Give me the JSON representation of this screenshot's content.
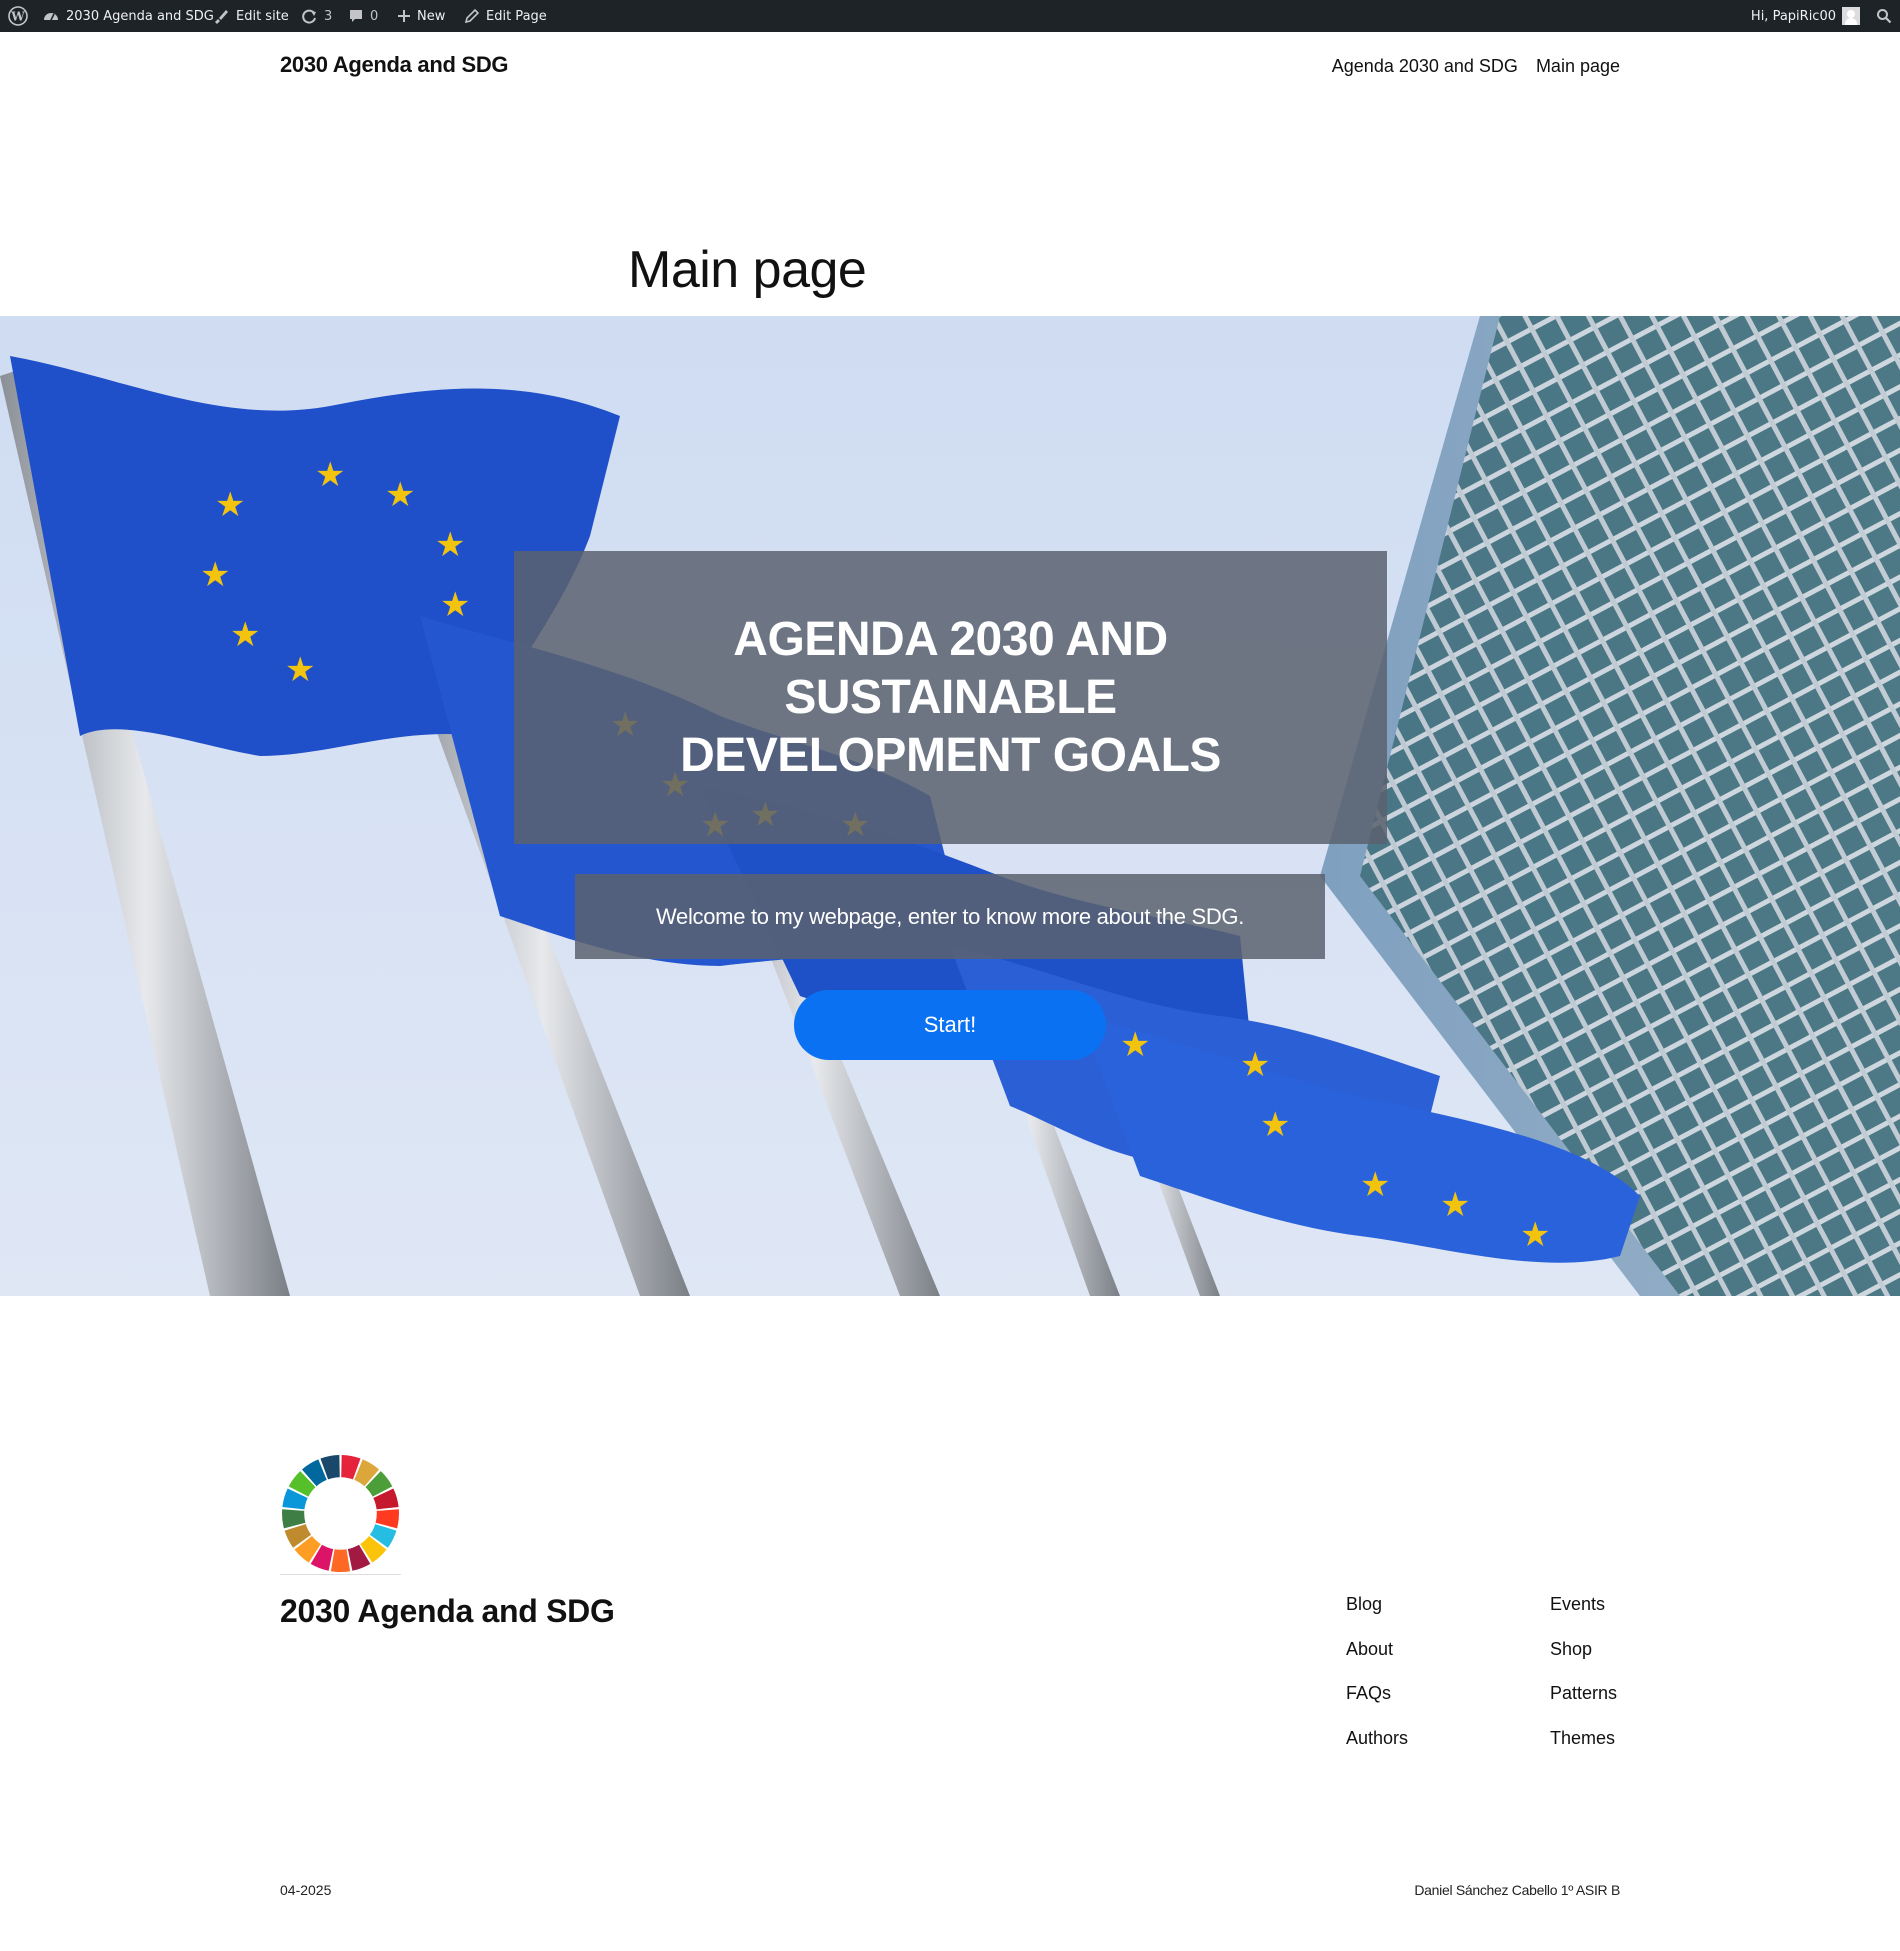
{
  "admin_bar": {
    "site_name": "2030 Agenda and SDG",
    "edit_site": "Edit site",
    "updates_count": "3",
    "comments_count": "0",
    "new_label": "New",
    "edit_page": "Edit Page",
    "greeting": "Hi, PapiRic00"
  },
  "header": {
    "site_title": "2030 Agenda and SDG",
    "nav": [
      "Agenda 2030 and SDG",
      "Main page"
    ]
  },
  "page": {
    "title": "Main page"
  },
  "hero": {
    "heading": "AGENDA 2030 AND SUSTAINABLE DEVELOPMENT GOALS",
    "subtext": "Welcome to my webpage, enter to know more about the SDG.",
    "button": "Start!",
    "button_color": "#0a72f2"
  },
  "footer": {
    "title": "2030 Agenda and SDG",
    "links_col1": [
      "Blog",
      "About",
      "FAQs",
      "Authors"
    ],
    "links_col2": [
      "Events",
      "Shop",
      "Patterns",
      "Themes"
    ],
    "date": "04-2025",
    "credit": "Daniel Sánchez Cabello 1º ASIR B"
  },
  "sdg_colors": [
    "#e5243b",
    "#dda63a",
    "#4c9f38",
    "#c5192d",
    "#ff3a21",
    "#26bde2",
    "#fcc30b",
    "#a21942",
    "#fd6925",
    "#dd1367",
    "#fd9d24",
    "#bf8b2e",
    "#3f7e44",
    "#0a97d9",
    "#56c02b",
    "#00689d",
    "#19486a"
  ]
}
